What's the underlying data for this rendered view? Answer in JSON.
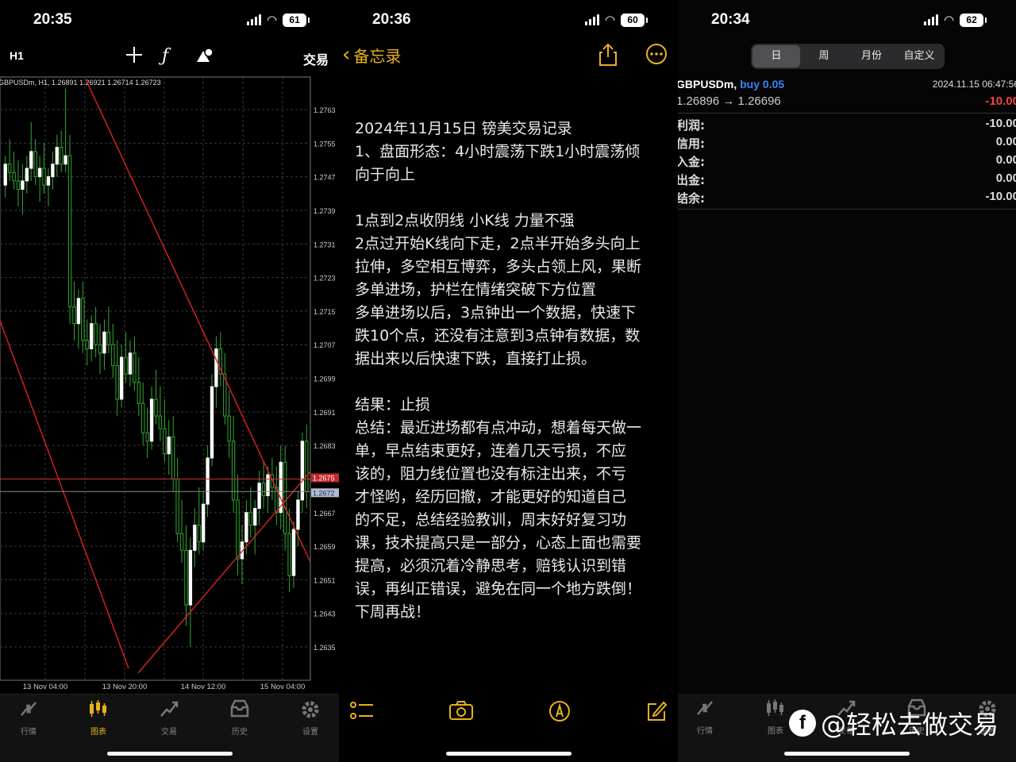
{
  "panel1": {
    "status": {
      "time": "20:35",
      "battery": "61"
    },
    "toolbar": {
      "timeframe": "H1",
      "crosshair_icon": "crosshair-icon",
      "indicator_icon": "function-icon",
      "objects_icon": "shapes-icon",
      "trade_label": "交易"
    },
    "chart_data": {
      "type": "candlestick",
      "title": "GBPUSDm, H1, 1.26891 1.26921 1.26714 1.26723",
      "y_ticks": [
        "1.2763",
        "1.2755",
        "1.2747",
        "1.2739",
        "1.2731",
        "1.2723",
        "1.2715",
        "1.2707",
        "1.2699",
        "1.2691",
        "1.2683",
        "1.2675",
        "1.2667",
        "1.2659",
        "1.2651",
        "1.2643",
        "1.2635"
      ],
      "ylim": [
        1.2628,
        1.277
      ],
      "x_ticks": [
        "13 Nov 04:00",
        "13 Nov 20:00",
        "14 Nov 12:00",
        "15 Nov 04:00"
      ],
      "current_price_labels": [
        "1.2675",
        "1.2672"
      ],
      "bull_color": "#ffffff",
      "bear_color": "#000000",
      "wick_color": "#2faa2f",
      "trendline_color": "#dd2222"
    },
    "tabs": [
      {
        "label": "行情",
        "icon": "quotes-icon",
        "active": false
      },
      {
        "label": "图表",
        "icon": "chart-icon",
        "active": true
      },
      {
        "label": "交易",
        "icon": "trade-icon",
        "active": false
      },
      {
        "label": "历史",
        "icon": "history-icon",
        "active": false
      },
      {
        "label": "设置",
        "icon": "settings-icon",
        "active": false
      }
    ]
  },
  "panel2": {
    "status": {
      "time": "20:36",
      "battery": "60"
    },
    "nav": {
      "back_label": "备忘录"
    },
    "note_lines": [
      "2024年11月15日 镑美交易记录",
      "1、盘面形态：4小时震荡下跌1小时震荡倾",
      "向于向上",
      "",
      "1点到2点收阴线 小K线 力量不强",
      "2点过开始K线向下走，2点半开始多头向上",
      "拉伸，多空相互博弈，多头占领上风，果断",
      "多单进场，护栏在情绪突破下方位置",
      "多单进场以后，3点钟出一个数据，快速下",
      "跌10个点，还没有注意到3点钟有数据，数",
      "据出来以后快速下跌，直接打止损。",
      "",
      "结果：止损",
      "总结：最近进场都有点冲动，想着每天做一",
      "单，早点结束更好，连着几天亏损，不应",
      "该的，阻力线位置也没有标注出来，不亏",
      "才怪哟，经历回撤，才能更好的知道自己",
      "的不足，总结经验教训，周末好好复习功",
      "课，技术提高只是一部分，心态上面也需要",
      "提高，必须沉着冷静思考，赔钱认识到错",
      "误，再纠正错误，避免在同一个地方跌倒！",
      "下周再战！"
    ]
  },
  "panel3": {
    "status": {
      "time": "20:34",
      "battery": "62"
    },
    "segments": [
      "日",
      "周",
      "月份",
      "自定义"
    ],
    "selected_segment": 0,
    "deal": {
      "symbol": "GBPUSDm,",
      "side": "buy 0.05",
      "date": "2024.11.15 06:47:56",
      "prices": "1.26896 → 1.26696",
      "profit": "-10.00"
    },
    "summary": [
      {
        "label": "利润:",
        "value": "-10.00"
      },
      {
        "label": "信用:",
        "value": "0.00"
      },
      {
        "label": "入金:",
        "value": "0.00"
      },
      {
        "label": "出金:",
        "value": "0.00"
      },
      {
        "label": "结余:",
        "value": "-10.00"
      }
    ],
    "tabs": [
      {
        "label": "行情",
        "icon": "quotes-icon"
      },
      {
        "label": "图表",
        "icon": "chart-icon"
      },
      {
        "label": "交易",
        "icon": "trade-icon"
      },
      {
        "label": "历史",
        "icon": "history-icon"
      },
      {
        "label": "设置",
        "icon": "settings-icon"
      }
    ],
    "watermark": "@轻松去做交易"
  }
}
